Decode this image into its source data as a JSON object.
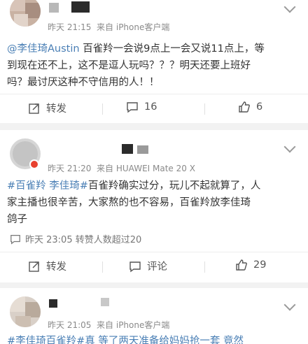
{
  "posts": [
    {
      "time": "昨天 21:15",
      "source": "来自 iPhone客户端",
      "mention": "@李佳琦Austin",
      "text_lines": [
        "百雀羚一会说9点上一会又说11点上，等",
        "到现在还不上，这不是逗人玩吗？？？明天还要上班好",
        "吗？最讨厌这种不守信用的人！！"
      ],
      "actions": {
        "repost": "转发",
        "comment": "16",
        "like": "6"
      }
    },
    {
      "time": "昨天 21:20",
      "source": "来自 HUAWEI Mate 20 X",
      "hashtag": "#百雀羚 李佳琦#",
      "text_lines": [
        "百雀羚确实过分，玩儿不起就算了，人",
        "家主播也很辛苦，大家熬的也不容易，百雀羚放李佳琦",
        "鸽子"
      ],
      "footer": "昨天 23:05 转赞人数超过20",
      "actions": {
        "repost": "转发",
        "comment": "评论",
        "like": "29"
      }
    },
    {
      "time": "昨天 21:05",
      "source": "来自 iPhone客户端",
      "text_partial": "#李佳琦百雀羚#真   等了两天准备给妈妈抢一套  竟然"
    }
  ],
  "icons": [
    "chevron-down-icon",
    "repost-icon",
    "comment-icon",
    "like-icon",
    "footer-comment-icon",
    "verified-badge-icon"
  ],
  "colors": {
    "link": "#4a7fb5",
    "background": "#f2f2f2",
    "card": "#ffffff",
    "badge": "#e8412f"
  }
}
